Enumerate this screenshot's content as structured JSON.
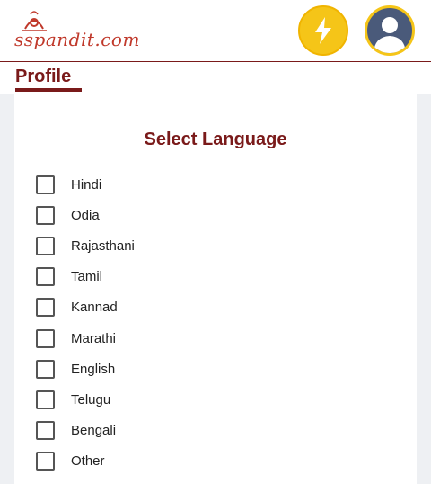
{
  "header": {
    "logo_text": "sspandit.com",
    "bolt_icon": "lightning-bolt-icon",
    "avatar_icon": "user-silhouette-icon",
    "colors": {
      "brand": "#7a1a1a",
      "logo": "#c0392b",
      "bolt_bg": "#f5c518",
      "avatar_bg": "#4a5a7a"
    }
  },
  "page": {
    "title": "Profile"
  },
  "language_selector": {
    "title": "Select Language",
    "options": [
      {
        "label": "Hindi",
        "checked": false
      },
      {
        "label": "Odia",
        "checked": false
      },
      {
        "label": "Rajasthani",
        "checked": false
      },
      {
        "label": "Tamil",
        "checked": false
      },
      {
        "label": "Kannad",
        "checked": false
      },
      {
        "label": "Marathi",
        "checked": false
      },
      {
        "label": "English",
        "checked": false
      },
      {
        "label": "Telugu",
        "checked": false
      },
      {
        "label": "Bengali",
        "checked": false
      },
      {
        "label": "Other",
        "checked": false
      }
    ]
  }
}
